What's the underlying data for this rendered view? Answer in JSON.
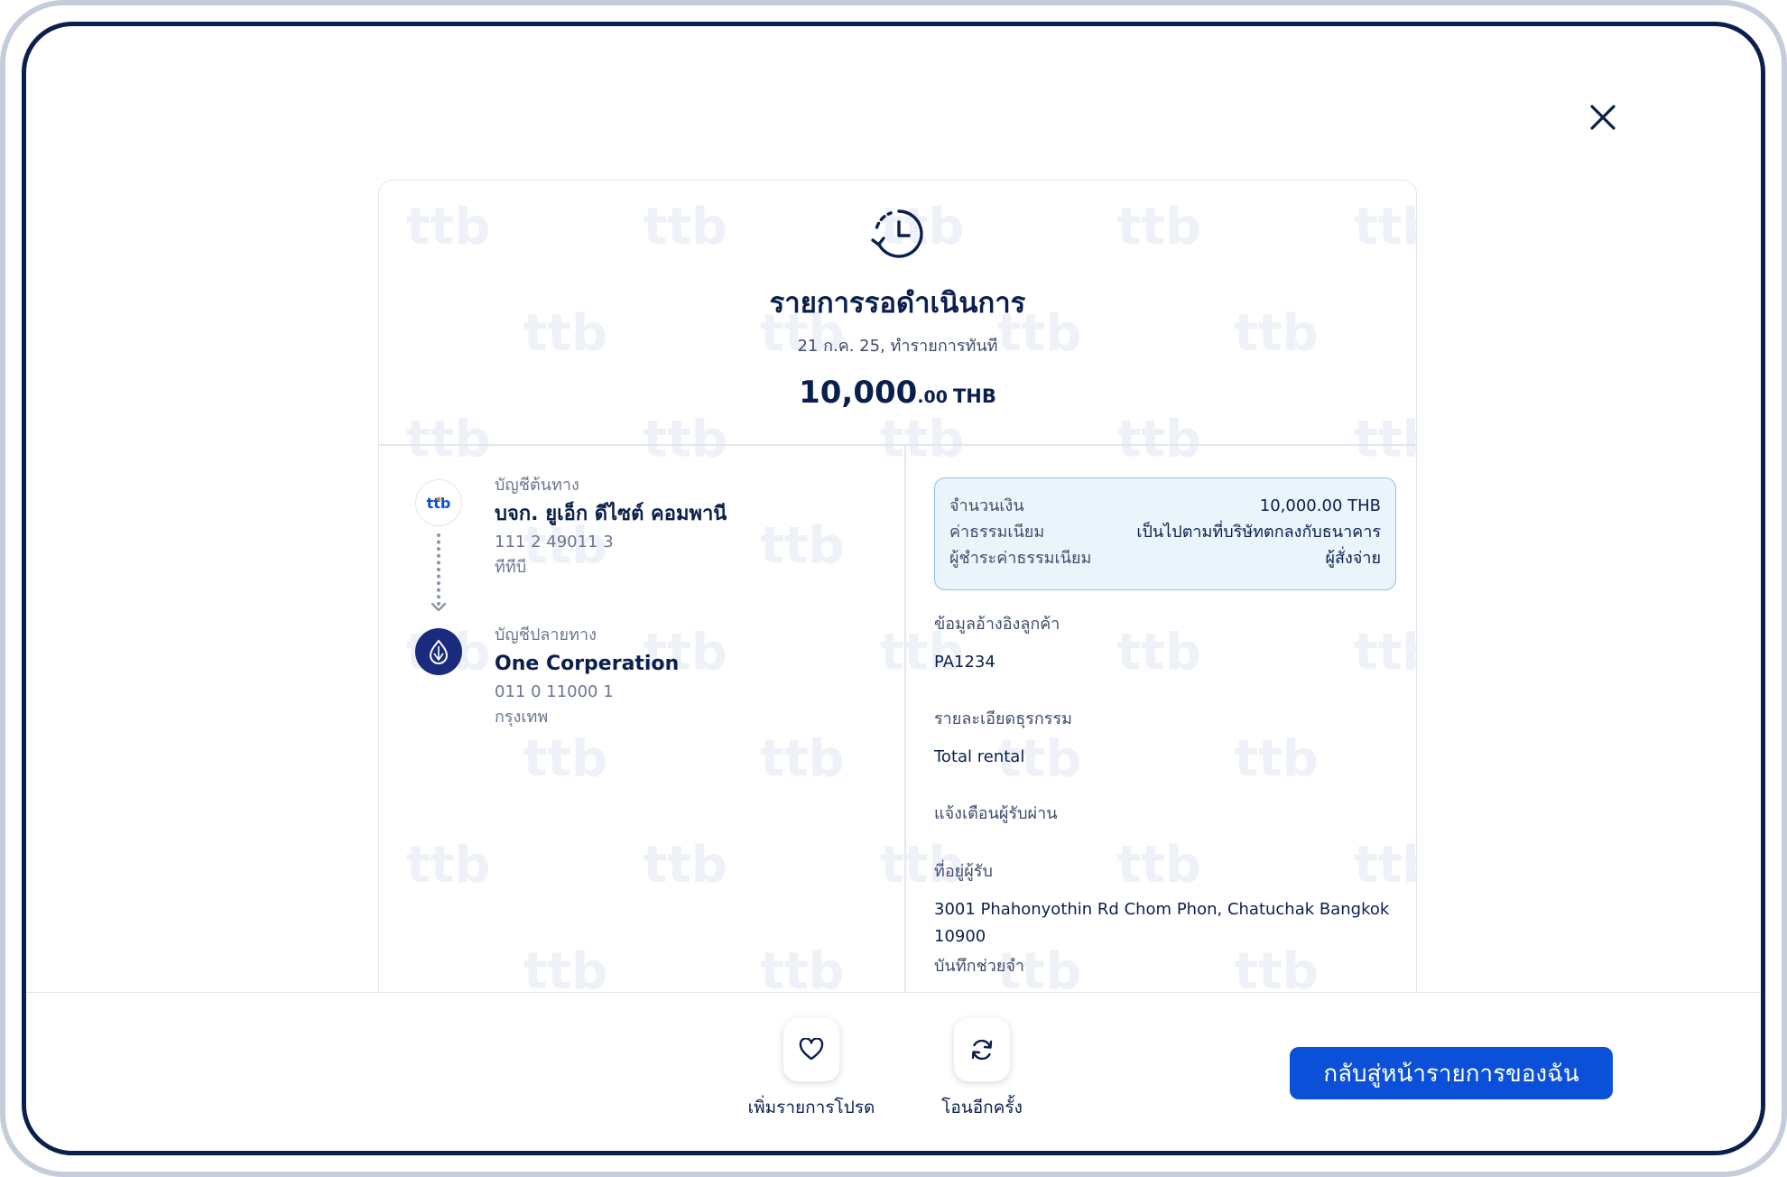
{
  "colors": {
    "navy": "#0b1f4f",
    "primary_blue": "#0b50d8",
    "summary_bg": "#eaf4fb",
    "summary_border": "#8bc4ea",
    "muted_text": "#6b7690",
    "dest_logo_bg": "#1a2a7d",
    "watermark": "#eef1f7"
  },
  "header": {
    "status_icon": "clock-history-icon",
    "title": "รายการรอดำเนินการ",
    "subtitle": "21 ก.ค. 25, ทำรายการทันที",
    "amount_int": "10,000",
    "amount_dec": ".00",
    "currency": "THB"
  },
  "watermark_text": "ttb",
  "source": {
    "label": "บัญชีต้นทาง",
    "logo_text": "ttb",
    "name": "บจก. ยูเอ็ก ดีไซต์ คอมพานี",
    "account_no": "111 2 49011 3",
    "bank": "ทีทีบี"
  },
  "destination": {
    "label": "บัญชีปลายทาง",
    "logo_icon": "bank-droplet-icon",
    "name": "One Corperation",
    "account_no": "011 0 11000 1",
    "bank": "กรุงเทพ"
  },
  "summary": {
    "amount_label": "จำนวนเงิน",
    "amount_value": "10,000.00 THB",
    "fee_label": "ค่าธรรมเนียม",
    "fee_value": "เป็นไปตามที่บริษัทตกลงกับธนาคาร",
    "fee_payer_label": "ผู้ชำระค่าธรรมเนียม",
    "fee_payer_value": "ผู้สั่งจ่าย"
  },
  "details": {
    "customer_ref_label": "ข้อมูลอ้างอิงลูกค้า",
    "customer_ref_value": "PA1234",
    "transaction_detail_label": "รายละเอียดธุรกรรม",
    "transaction_detail_value": "Total rental",
    "notify_label": "แจ้งเตือนผู้รับผ่าน",
    "address_label": "ที่อยู่ผู้รับ",
    "address_value": "3001 Phahonyothin Rd Chom Phon, Chatuchak Bangkok 10900",
    "memo_label": "บันทึกช่วยจำ"
  },
  "actions": {
    "favorite_label": "เพิ่มรายการโปรด",
    "repeat_label": "โอนอีกครั้ง",
    "primary_label": "กลับสู่หน้ารายการของฉัน"
  }
}
